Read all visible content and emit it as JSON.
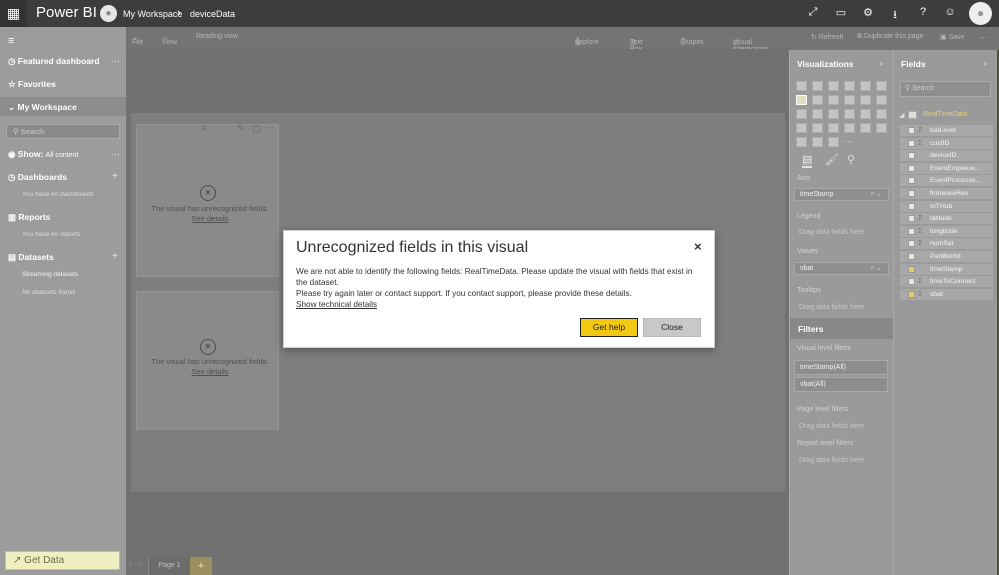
{
  "app": {
    "brand": "Power BI",
    "workspace": "My Workspace",
    "report": "deviceData"
  },
  "nav": {
    "featured": "Featured dashboard",
    "favorites": "Favorites",
    "workspace": "My Workspace",
    "search_placeholder": "Search",
    "show": "Show:",
    "show_value": "All content",
    "dashboards": "Dashboards",
    "no_dashboards": "You have no dashboards",
    "reports": "Reports",
    "no_reports": "You have no reports",
    "datasets": "Datasets",
    "streaming": "Streaming datasets",
    "no_datasets": "No datasets found",
    "get_data": "Get Data"
  },
  "ribbon": {
    "file": "File",
    "view": "View",
    "reading": "Reading view",
    "explore": "Explore",
    "textbox": "Text Box",
    "shapes": "Shapes",
    "interactions": "Visual Interactions",
    "refresh": "Refresh",
    "duplicate": "Duplicate this page",
    "save": "Save"
  },
  "visual": {
    "message": "The visual has unrecognized fields.",
    "link": "See details"
  },
  "pages": {
    "tab": "Page 1",
    "add": "+"
  },
  "viz_pane": {
    "title": "Visualizations",
    "axis": "Axis",
    "axis_value": "timeStamp",
    "legend": "Legend",
    "drop": "Drag data fields here",
    "values": "Values",
    "values_value": "vbat",
    "tooltips": "Tooltips",
    "filters": "Filters",
    "visual_filters": "Visual level filters",
    "filter1": "timeStamp(All)",
    "filter2": "vbat(All)",
    "page_filters": "Page level filters",
    "report_filters": "Report level filters"
  },
  "fields_pane": {
    "title": "Fields",
    "search_placeholder": "Search",
    "table": "RealTimeData",
    "fields": [
      {
        "name": "batLevel",
        "sigma": true,
        "checked": false
      },
      {
        "name": "custID",
        "sigma": true,
        "checked": false
      },
      {
        "name": "deviceID",
        "sigma": false,
        "checked": false
      },
      {
        "name": "EventEnqueue...",
        "sigma": false,
        "checked": false
      },
      {
        "name": "EventProcesse...",
        "sigma": false,
        "checked": false
      },
      {
        "name": "firmwareRev",
        "sigma": false,
        "checked": false
      },
      {
        "name": "IoTHub",
        "sigma": false,
        "checked": false
      },
      {
        "name": "latitude",
        "sigma": true,
        "checked": false
      },
      {
        "name": "longitude",
        "sigma": true,
        "checked": false
      },
      {
        "name": "numSat",
        "sigma": true,
        "checked": false
      },
      {
        "name": "PartitionId",
        "sigma": false,
        "checked": false
      },
      {
        "name": "timeStamp",
        "sigma": false,
        "checked": true
      },
      {
        "name": "timeToConnect",
        "sigma": true,
        "checked": false
      },
      {
        "name": "vbat",
        "sigma": true,
        "checked": true
      }
    ]
  },
  "dialog": {
    "title": "Unrecognized fields in this visual",
    "close_icon": "×",
    "line1": "We are not able to identify the following fields: RealTimeData. Please update the visual with fields that exist in the dataset.",
    "line2": "Please try again later or contact support. If you contact support, please provide these details.",
    "link": "Show technical details",
    "primary": "Get help",
    "secondary": "Close"
  },
  "colors": {
    "accent": "#f2c811",
    "topbar": "#3d3d3d"
  }
}
